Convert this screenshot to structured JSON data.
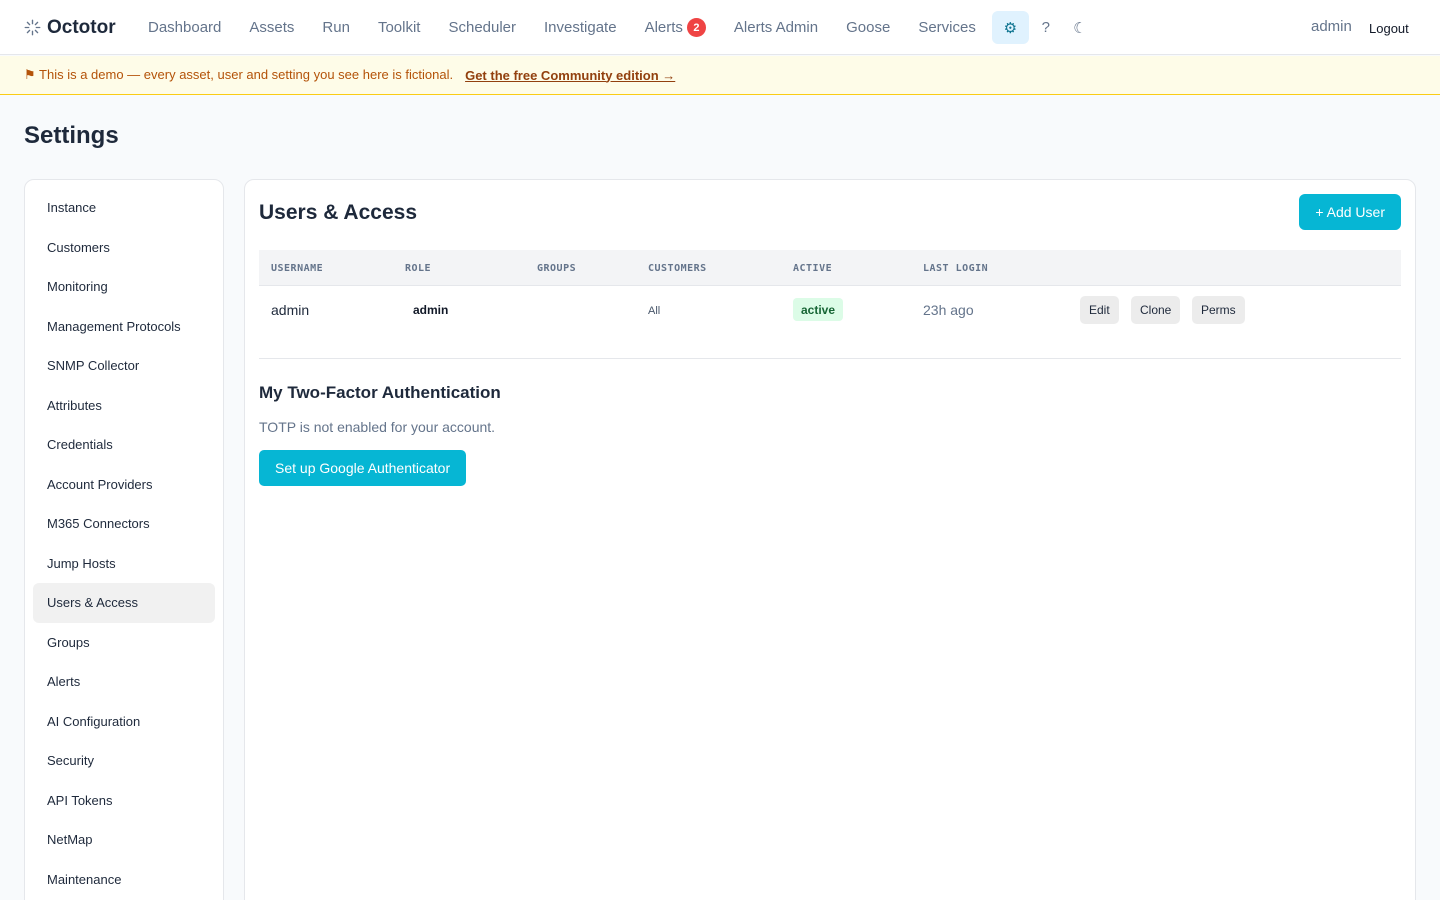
{
  "brand": {
    "name": "Octotor",
    "logo_icon": "sparkle-logo-icon"
  },
  "nav": {
    "links": [
      "Dashboard",
      "Assets",
      "Run",
      "Toolkit",
      "Scheduler",
      "Investigate",
      "Alerts",
      "Alerts Admin",
      "Goose",
      "Services"
    ],
    "alerts_badge": "2",
    "settings_icon": "⚙",
    "help_label": "?",
    "theme_icon": "☾",
    "user": "admin",
    "logout": "Logout"
  },
  "banner": {
    "text": "⚑ This is a demo — every asset, user and setting you see here is fictional.",
    "link": "Get the free Community edition →"
  },
  "page": {
    "title": "Settings"
  },
  "sidebar": {
    "items": [
      "Instance",
      "Customers",
      "Monitoring",
      "Management Protocols",
      "SNMP Collector",
      "Attributes",
      "Credentials",
      "Account Providers",
      "M365 Connectors",
      "Jump Hosts",
      "Users & Access",
      "Groups",
      "Alerts",
      "AI Configuration",
      "Security",
      "API Tokens",
      "NetMap",
      "Maintenance"
    ],
    "active": "Users & Access"
  },
  "users": {
    "title": "Users & Access",
    "add_button": "+ Add User",
    "columns": [
      "USERNAME",
      "ROLE",
      "GROUPS",
      "CUSTOMERS",
      "ACTIVE",
      "LAST LOGIN"
    ],
    "rows": [
      {
        "username": "admin",
        "role": "admin",
        "groups": "",
        "customers": "All",
        "active": "active",
        "last_login": "23h ago",
        "actions": [
          "Edit",
          "Clone",
          "Perms"
        ]
      }
    ]
  },
  "tfa": {
    "title": "My Two-Factor Authentication",
    "text": "TOTP is not enabled for your account.",
    "button": "Set up Google Authenticator"
  },
  "colors": {
    "accent": "#06b6d4",
    "badge": "#ef4444",
    "active_bg": "#dcfce7",
    "active_text": "#166534",
    "banner_bg": "#fefce8"
  }
}
